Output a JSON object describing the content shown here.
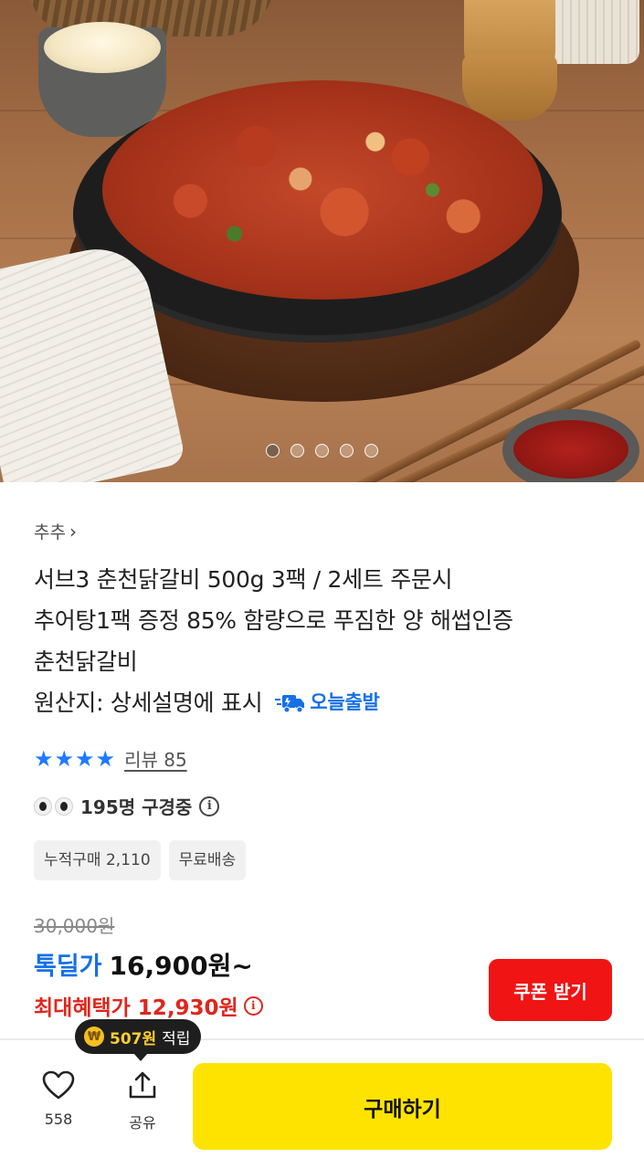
{
  "hero": {
    "slide_count": 5,
    "active_slide": 1
  },
  "product": {
    "store_name": "추추",
    "title_line1": "서브3 춘천닭갈비 500g 3팩 / 2세트 주문시",
    "title_line2": "추어탕1팩 증정 85% 함량으로 푸짐한 양 해썹인증",
    "title_line3": "춘천닭갈비",
    "origin_text": "원산지: 상세설명에 표시",
    "dispatch_label": "오늘출발",
    "rating_stars": 4,
    "review_label": "리뷰 85",
    "viewers_text": "195명 구경중",
    "chips": [
      "누적구매 2,110",
      "무료배송"
    ]
  },
  "price": {
    "original": "30,000원",
    "deal_label": "톡딜가",
    "deal_price": "16,900원~",
    "max_benefit": "최대혜택가 12,930원",
    "coupon_button": "쿠폰 받기"
  },
  "bottom_bar": {
    "points_amount": "507원",
    "points_label": "적립",
    "like_count": "558",
    "share_label": "공유",
    "buy_button": "구매하기"
  },
  "colors": {
    "accent_blue": "#1570e6",
    "star_blue": "#1f7aff",
    "benefit_red": "#e0261c",
    "coupon_red": "#f01414",
    "buy_yellow": "#ffe300"
  }
}
